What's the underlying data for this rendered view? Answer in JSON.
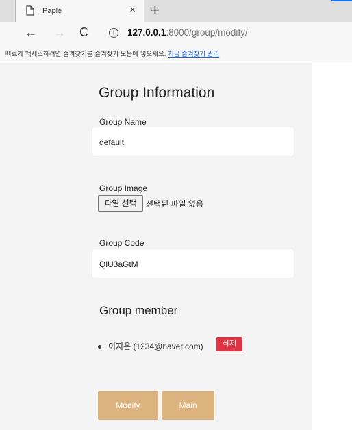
{
  "browser": {
    "tab_title": "Paple",
    "tab_close": "×",
    "new_tab": "+",
    "nav": {
      "back": "←",
      "forward": "→",
      "reload": "C"
    },
    "url": {
      "host": "127.0.0.1",
      "port_path": ":8000/group/modify/"
    },
    "bookmark_prompt": "빠르게 액세스하려면 즐겨찾기를 즐겨찾기 모음에 넣으세요.",
    "bookmark_link": "지금 즐겨찾기 관리"
  },
  "page": {
    "title": "Group Information",
    "group_name": {
      "label": "Group Name",
      "value": "default"
    },
    "group_image": {
      "label": "Group Image",
      "button": "파일 선택",
      "status": "선택된 파일 없음"
    },
    "group_code": {
      "label": "Group Code",
      "value": "QlU3aGtM"
    },
    "members": {
      "title": "Group member",
      "items": [
        {
          "text": "이지은 (1234@naver.com)",
          "delete_label": "삭제"
        }
      ]
    },
    "buttons": {
      "modify": "Modify",
      "main": "Main"
    }
  },
  "colors": {
    "accent": "#dcb27e",
    "danger": "#dc3545",
    "link": "#1a5dd6"
  }
}
